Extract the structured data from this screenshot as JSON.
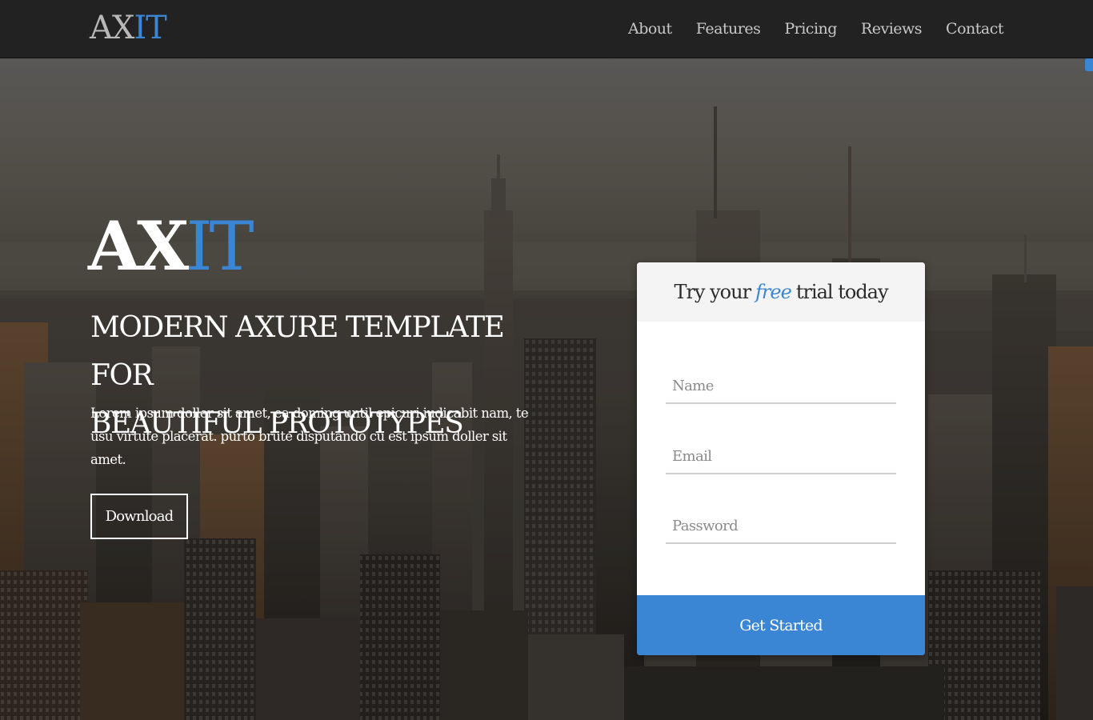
{
  "nav": {
    "logo_ax": "AX",
    "logo_it": "IT",
    "links": [
      "About",
      "Features",
      "Pricing",
      "Reviews",
      "Contact"
    ]
  },
  "hero": {
    "logo_ax": "AX",
    "logo_it": "IT",
    "headline_line1": "MODERN AXURE TEMPLATE FOR",
    "headline_line2": "BEAUTIFUL PROTOTYPES",
    "paragraph": "Lorem ipsum doller sit amet, ea doming until epicuri iudicabit nam, te usu virtute placerat. purto brute disputando cu est ipsum doller sit amet.",
    "download_label": "Download"
  },
  "signup": {
    "title_before": "Try your",
    "title_highlight": "free",
    "title_after": "trial today",
    "name_placeholder": "Name",
    "email_placeholder": "Email",
    "password_placeholder": "Password",
    "submit_label": "Get Started"
  },
  "colors": {
    "accent": "#3a86d4",
    "navbar_bg": "#222222",
    "card_header_bg": "#f4f4f4"
  }
}
